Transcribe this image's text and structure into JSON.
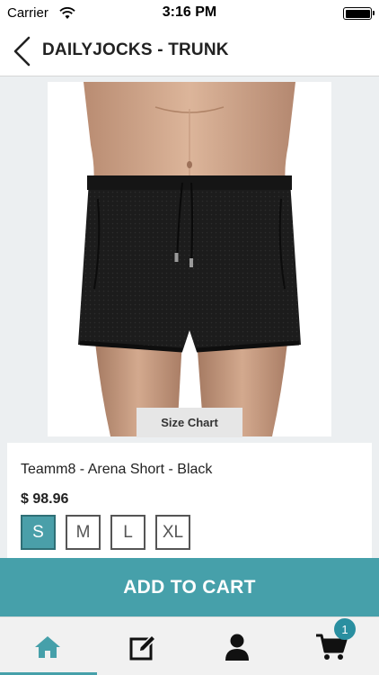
{
  "status_bar": {
    "carrier": "Carrier",
    "time": "3:16 PM",
    "battery_level": 1.0
  },
  "nav": {
    "title": "DAILYJOCKS - TRUNK",
    "back_icon": "chevron-left-icon"
  },
  "product": {
    "image_icon": "black-mesh-shorts-photo",
    "size_chart_label": "Size Chart",
    "name": "Teamm8 - Arena Short - Black",
    "price": "$ 98.96",
    "sizes": [
      "S",
      "M",
      "L",
      "XL"
    ],
    "selected_size": "S"
  },
  "actions": {
    "add_to_cart_label": "ADD TO CART"
  },
  "tab_bar": {
    "tabs": [
      {
        "name": "home",
        "icon": "home-icon",
        "active": true
      },
      {
        "name": "edit",
        "icon": "edit-icon",
        "active": false
      },
      {
        "name": "account",
        "icon": "user-icon",
        "active": false
      },
      {
        "name": "cart",
        "icon": "cart-icon",
        "active": false
      }
    ],
    "cart_badge": "1"
  },
  "colors": {
    "accent": "#46a0aa",
    "badge": "#2a8fa0",
    "selected_size_bg": "#4a9fa9"
  }
}
